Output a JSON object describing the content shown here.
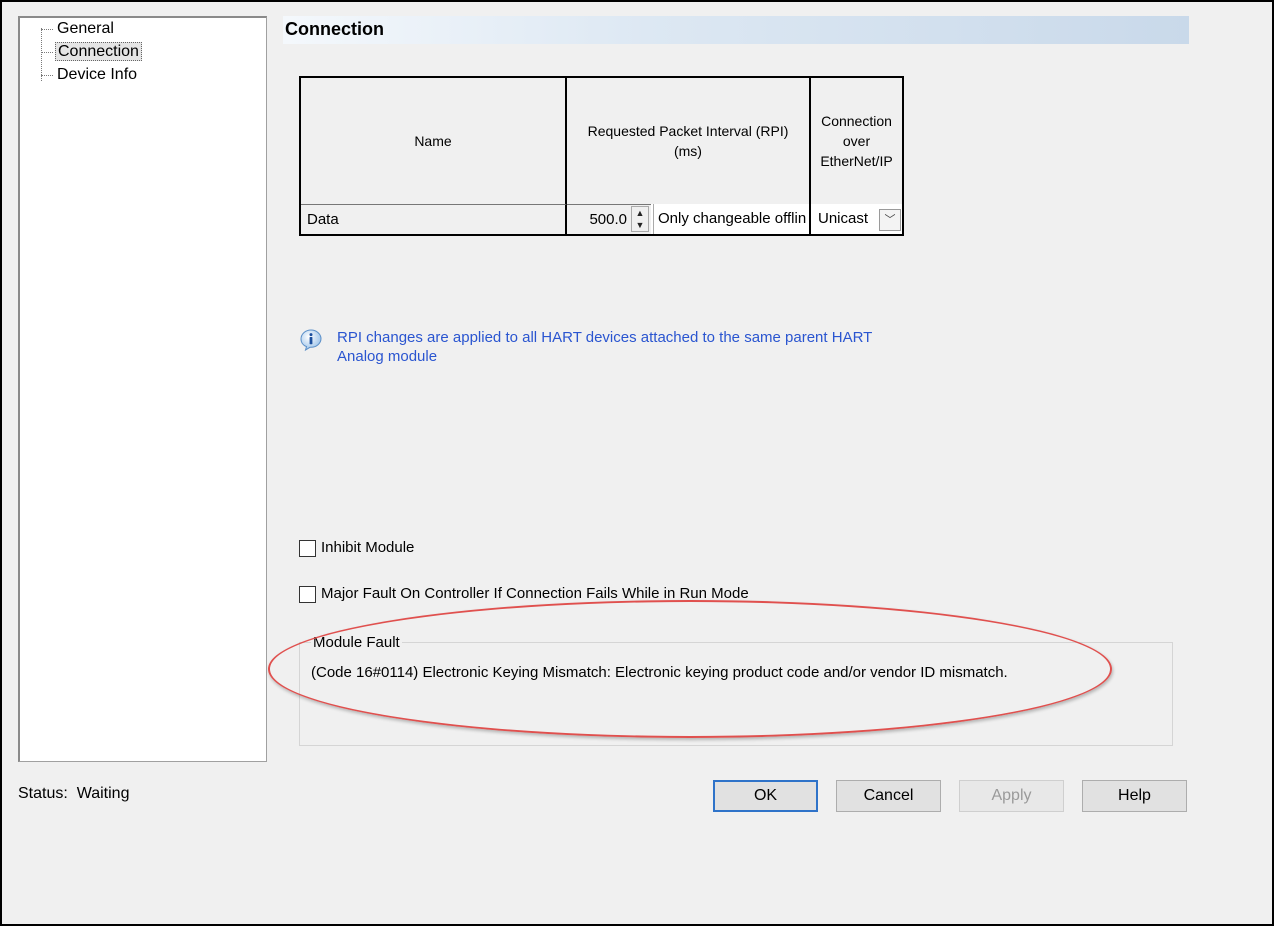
{
  "tree": {
    "items": [
      {
        "label": "General"
      },
      {
        "label": "Connection"
      },
      {
        "label": "Device Info"
      }
    ]
  },
  "header": {
    "title": "Connection"
  },
  "grid": {
    "columns": [
      "Name",
      "Requested Packet Interval (RPI)\n(ms)",
      "Connection\nover\nEtherNet/IP"
    ],
    "rows": [
      {
        "name": "Data",
        "rpi": "500.0",
        "rpi_note": "Only changeable offlin",
        "connection": "Unicast"
      }
    ]
  },
  "info": {
    "icon": "info-icon",
    "text": "RPI changes are applied to all HART devices attached to the same parent HART Analog module"
  },
  "checkboxes": [
    {
      "label": "Inhibit Module",
      "checked": false
    },
    {
      "label": "Major Fault On Controller If Connection Fails While in Run Mode",
      "checked": false
    }
  ],
  "fault": {
    "legend": "Module Fault",
    "message": "(Code 16#0114) Electronic Keying Mismatch: Electronic keying product code and/or vendor ID mismatch."
  },
  "status": {
    "label": "Status:",
    "value": "Waiting"
  },
  "buttons": {
    "ok": "OK",
    "cancel": "Cancel",
    "apply": "Apply",
    "help": "Help"
  },
  "colors": {
    "info_text": "#2a55d0",
    "highlight_ellipse": "#e0504e",
    "default_button_border": "#2f73c9"
  }
}
